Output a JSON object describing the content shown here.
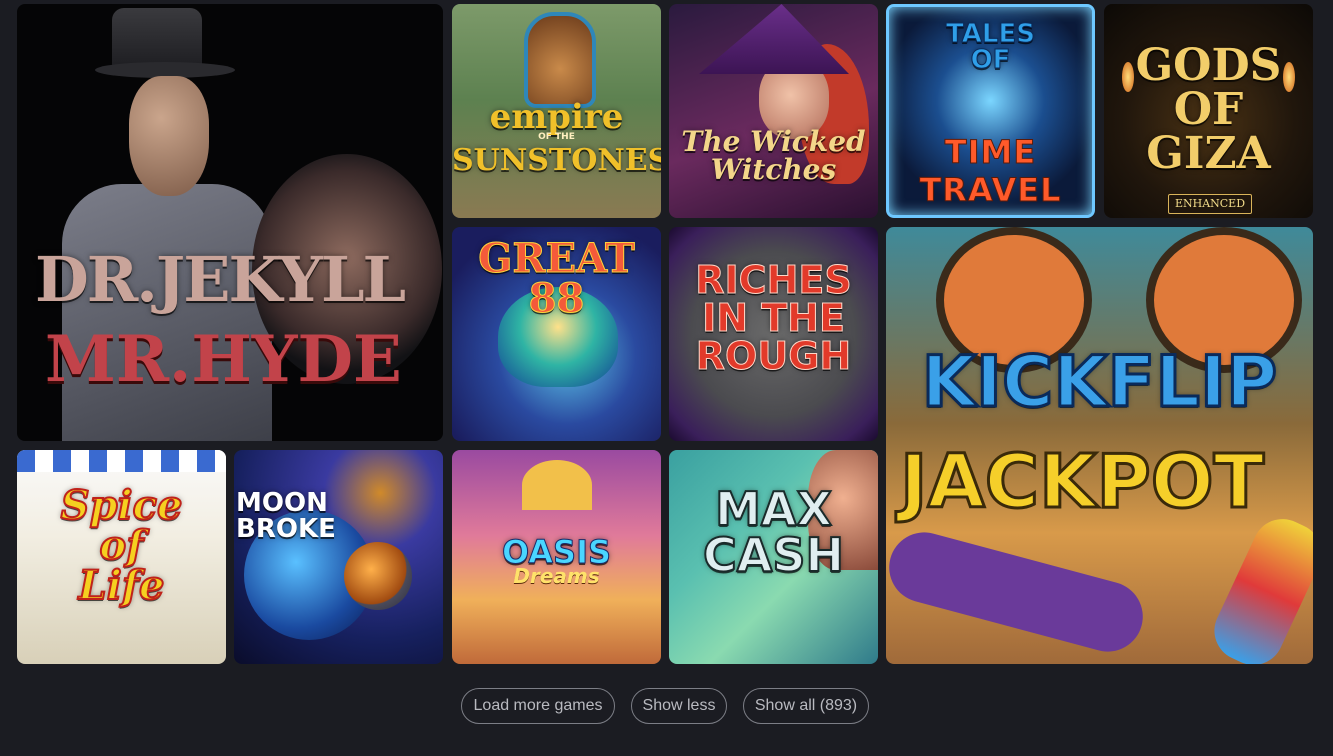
{
  "games": {
    "jekyll": {
      "title": "DR.JEKYLL",
      "amp": "&",
      "title2": "MR.HYDE"
    },
    "empire": {
      "title": "empire",
      "of_the": "OF THE",
      "title2": "SUNSTONES"
    },
    "witches": {
      "title": "The Wicked\nWitches"
    },
    "tales": {
      "title": "TALES\nOF",
      "title2": "TIME\nTRAVEL"
    },
    "giza": {
      "title": "GODS\nOF\nGIZA",
      "badge": "ENHANCED"
    },
    "great88": {
      "title": "GREAT 88"
    },
    "riches": {
      "title": "RICHES\nIN THE\nROUGH"
    },
    "kickflip": {
      "title": "KICKFLIP",
      "title2": "JACKPOT"
    },
    "spice": {
      "title": "Spice\nof\nLife"
    },
    "moon": {
      "title": "MOON\nBROKE"
    },
    "oasis": {
      "title": "OASIS",
      "title2": "Dreams"
    },
    "maxcash": {
      "title": "MAX\nCASH"
    }
  },
  "buttons": {
    "load_more": "Load more games",
    "show_less": "Show less",
    "show_all": "Show all (893)"
  }
}
